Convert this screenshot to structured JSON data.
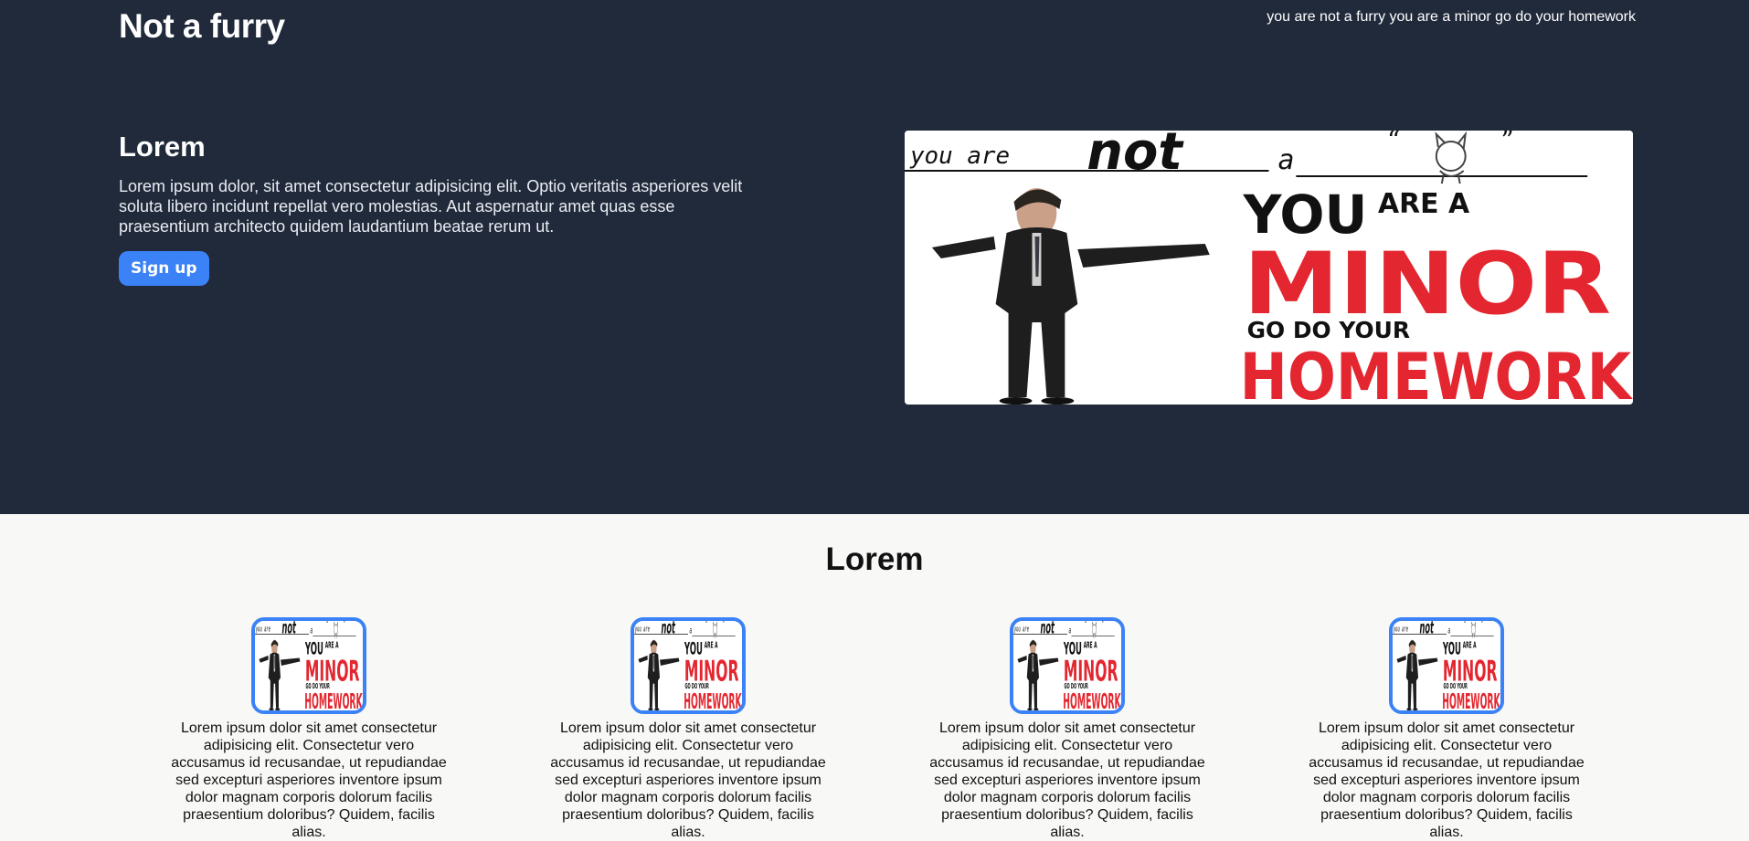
{
  "header": {
    "brand": "Not a furry",
    "top_link": "you are not a furry you are a minor go do your homework"
  },
  "hero": {
    "title": "Lorem",
    "body": "Lorem ipsum dolor, sit amet consectetur adipisicing elit. Optio veritatis asperiores velit soluta libero incidunt repellat vero molestias. Aut aspernatur amet quas esse praesentium architecto quidem laudantium beatae rerum ut.",
    "button_label": "Sign up",
    "image": {
      "line1_a": "you are",
      "line1_b": "not",
      "line1_c": "a",
      "l2a": "YOU",
      "l2b": "ARE A",
      "l3": "MINOR",
      "l4": "GO DO YOUR",
      "l5": "HOMEWORK"
    }
  },
  "features": {
    "title": "Lorem",
    "cards": [
      {
        "text": "Lorem ipsum dolor sit amet consectetur adipisicing elit. Consectetur vero accusamus id recusandae, ut repudiandae sed excepturi asperiores inventore ipsum dolor magnam corporis dolorum facilis praesentium doloribus? Quidem, facilis alias."
      },
      {
        "text": "Lorem ipsum dolor sit amet consectetur adipisicing elit. Consectetur vero accusamus id recusandae, ut repudiandae sed excepturi asperiores inventore ipsum dolor magnam corporis dolorum facilis praesentium doloribus? Quidem, facilis alias."
      },
      {
        "text": "Lorem ipsum dolor sit amet consectetur adipisicing elit. Consectetur vero accusamus id recusandae, ut repudiandae sed excepturi asperiores inventore ipsum dolor magnam corporis dolorum facilis praesentium doloribus? Quidem, facilis alias."
      },
      {
        "text": "Lorem ipsum dolor sit amet consectetur adipisicing elit. Consectetur vero accusamus id recusandae, ut repudiandae sed excepturi asperiores inventore ipsum dolor magnam corporis dolorum facilis praesentium doloribus? Quidem, facilis alias."
      }
    ]
  },
  "colors": {
    "hero_bg": "#212a3b",
    "accent": "#3b82f6",
    "meme_red": "#e3262f",
    "section_bg": "#f8f8f6"
  }
}
